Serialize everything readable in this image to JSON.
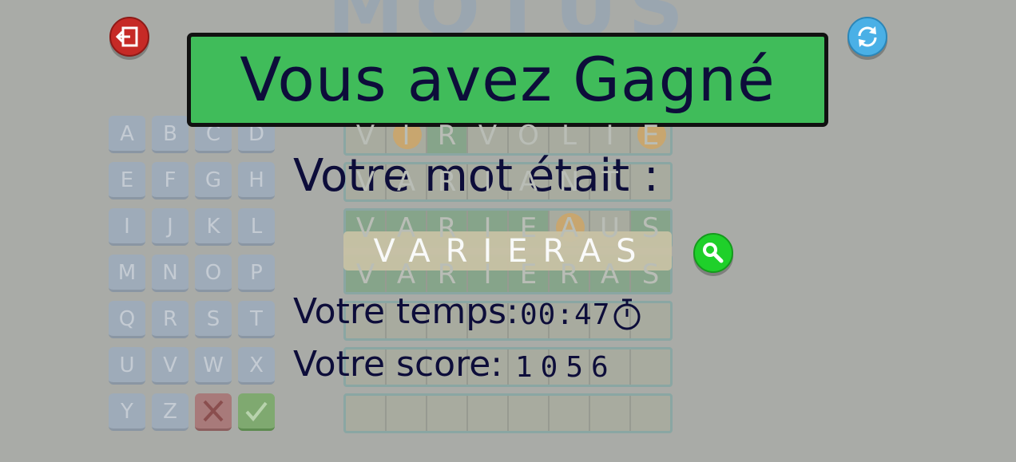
{
  "logo": {
    "text": "MOTUS"
  },
  "buttons": {
    "exit": {
      "icon": "exit-icon",
      "color": "#c62a26"
    },
    "restart": {
      "icon": "refresh-icon",
      "color": "#4ab0e6"
    },
    "reveal": {
      "icon": "search-icon",
      "color": "#1fd02a"
    }
  },
  "keyboard": {
    "keys": [
      "A",
      "B",
      "C",
      "D",
      "E",
      "F",
      "G",
      "H",
      "I",
      "J",
      "K",
      "L",
      "M",
      "N",
      "O",
      "P",
      "Q",
      "R",
      "S",
      "T",
      "U",
      "V",
      "W",
      "X",
      "Y",
      "Z"
    ],
    "delete_icon": "cross-icon",
    "submit_icon": "check-icon"
  },
  "grid": {
    "rows": [
      [
        {
          "l": "V",
          "s": ""
        },
        {
          "l": "I",
          "s": "o"
        },
        {
          "l": "R",
          "s": "g"
        },
        {
          "l": "V",
          "s": ""
        },
        {
          "l": "O",
          "s": ""
        },
        {
          "l": "L",
          "s": ""
        },
        {
          "l": "I",
          "s": ""
        },
        {
          "l": "E",
          "s": "o"
        }
      ],
      [
        {
          "l": "V",
          "s": ""
        },
        {
          "l": "A",
          "s": ""
        },
        {
          "l": "R",
          "s": ""
        },
        {
          "l": "I",
          "s": ""
        },
        {
          "l": "A",
          "s": ""
        },
        {
          "l": "N",
          "s": ""
        },
        {
          "l": "T",
          "s": ""
        },
        {
          "l": "",
          "s": ""
        }
      ],
      [
        {
          "l": "V",
          "s": "g"
        },
        {
          "l": "A",
          "s": "g"
        },
        {
          "l": "R",
          "s": "g"
        },
        {
          "l": "I",
          "s": "g"
        },
        {
          "l": "E",
          "s": "g"
        },
        {
          "l": "A",
          "s": "o"
        },
        {
          "l": "U",
          "s": ""
        },
        {
          "l": "S",
          "s": "g"
        }
      ],
      [
        {
          "l": "V",
          "s": "g"
        },
        {
          "l": "A",
          "s": "g"
        },
        {
          "l": "R",
          "s": "g"
        },
        {
          "l": "I",
          "s": "g"
        },
        {
          "l": "E",
          "s": "g"
        },
        {
          "l": "R",
          "s": "g"
        },
        {
          "l": "A",
          "s": "g"
        },
        {
          "l": "S",
          "s": "g"
        }
      ],
      [
        {
          "l": "",
          "s": ""
        },
        {
          "l": "",
          "s": ""
        },
        {
          "l": "",
          "s": ""
        },
        {
          "l": "",
          "s": ""
        },
        {
          "l": "",
          "s": ""
        },
        {
          "l": "",
          "s": ""
        },
        {
          "l": "",
          "s": ""
        },
        {
          "l": "",
          "s": ""
        }
      ],
      [
        {
          "l": "",
          "s": ""
        },
        {
          "l": "",
          "s": ""
        },
        {
          "l": "",
          "s": ""
        },
        {
          "l": "",
          "s": ""
        },
        {
          "l": "",
          "s": ""
        },
        {
          "l": "",
          "s": ""
        },
        {
          "l": "",
          "s": ""
        },
        {
          "l": "",
          "s": ""
        }
      ],
      [
        {
          "l": "",
          "s": ""
        },
        {
          "l": "",
          "s": ""
        },
        {
          "l": "",
          "s": ""
        },
        {
          "l": "",
          "s": ""
        },
        {
          "l": "",
          "s": ""
        },
        {
          "l": "",
          "s": ""
        },
        {
          "l": "",
          "s": ""
        },
        {
          "l": "",
          "s": ""
        }
      ]
    ]
  },
  "result": {
    "title": "Vous avez Gagné",
    "word_label": "Votre mot était :",
    "word": "VARIERAS",
    "time_label": "Votre temps:",
    "time_value": "00:47",
    "time_icon": "stopwatch-icon",
    "score_label": "Votre score:",
    "score_value": "1056"
  },
  "colors": {
    "banner": "#40bc5a",
    "text_dark": "#0d0d3a",
    "well_placed": "#86a48a",
    "misplaced": "#c8a66f"
  }
}
